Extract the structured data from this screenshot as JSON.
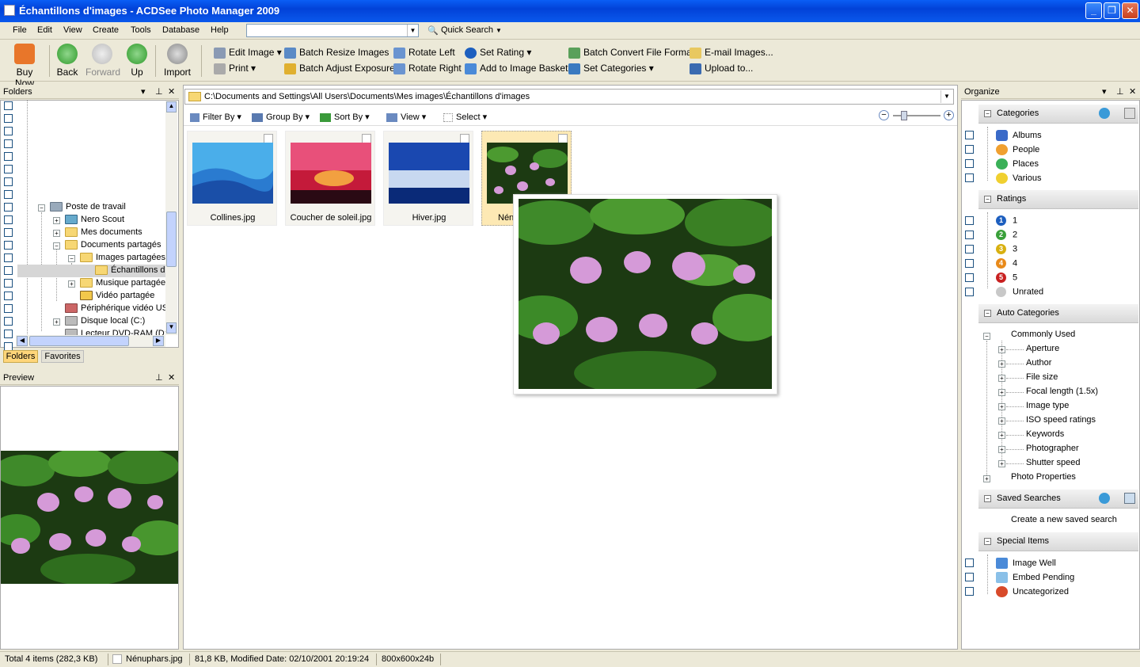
{
  "window": {
    "title": "Échantillons d'images - ACDSee Photo Manager 2009"
  },
  "menu": [
    "File",
    "Edit",
    "View",
    "Create",
    "Tools",
    "Database",
    "Help"
  ],
  "quick_search": {
    "value": "",
    "label": "Quick Search"
  },
  "toolbar": {
    "buy_now": "Buy Now",
    "back": "Back",
    "forward": "Forward",
    "up": "Up",
    "import": "Import",
    "edit_image": "Edit Image",
    "print": "Print",
    "batch_resize": "Batch Resize Images",
    "batch_adjust": "Batch Adjust Exposure",
    "rotate_left": "Rotate Left",
    "rotate_right": "Rotate Right",
    "set_rating": "Set Rating",
    "add_basket": "Add to Image Basket",
    "batch_convert": "Batch Convert File Format",
    "set_categories": "Set Categories",
    "email": "E-mail Images...",
    "upload": "Upload to..."
  },
  "folders": {
    "title": "Folders",
    "items": [
      "Poste de travail",
      "Nero Scout",
      "Mes documents",
      "Documents partagés",
      "Images partagées",
      "Échantillons d'i",
      "Musique partagée",
      "Vidéo partagée",
      "Périphérique vidéo USI",
      "Disque local (C:)",
      "Lecteur DVD-RAM (D:)"
    ],
    "tabs": [
      "Folders",
      "Favorites"
    ]
  },
  "preview": {
    "title": "Preview"
  },
  "browser": {
    "path": "C:\\Documents and Settings\\All Users\\Documents\\Mes images\\Échantillons d'images",
    "filter_by": "Filter By",
    "group_by": "Group By",
    "sort_by": "Sort By",
    "view": "View",
    "select": "Select",
    "thumbs": [
      "Collines.jpg",
      "Coucher de soleil.jpg",
      "Hiver.jpg",
      "Nénuphars.jpg"
    ],
    "thumb_4_visible": "Nénu"
  },
  "organize": {
    "title": "Organize",
    "categories": {
      "title": "Categories",
      "items": [
        "Albums",
        "People",
        "Places",
        "Various"
      ]
    },
    "ratings": {
      "title": "Ratings",
      "items": [
        "1",
        "2",
        "3",
        "4",
        "5"
      ],
      "unrated": "Unrated"
    },
    "auto_categories": {
      "title": "Auto Categories",
      "commonly_used": "Commonly Used",
      "items": [
        "Aperture",
        "Author",
        "File size",
        "Focal length (1.5x)",
        "Image type",
        "ISO speed ratings",
        "Keywords",
        "Photographer",
        "Shutter speed"
      ],
      "photo_properties": "Photo Properties"
    },
    "saved_searches": {
      "title": "Saved Searches",
      "create": "Create a new saved search"
    },
    "special_items": {
      "title": "Special Items",
      "items": [
        "Image Well",
        "Embed Pending",
        "Uncategorized"
      ]
    }
  },
  "status": {
    "total": "Total 4 items  (282,3 KB)",
    "file": "Nénuphars.jpg",
    "info": "81,8 KB, Modified Date: 02/10/2001 20:19:24",
    "dims": "800x600x24b"
  },
  "colors": {
    "titlebar": "#0a5ef5",
    "selection": "#fde9b4",
    "status_bg": "#ece9d8"
  }
}
